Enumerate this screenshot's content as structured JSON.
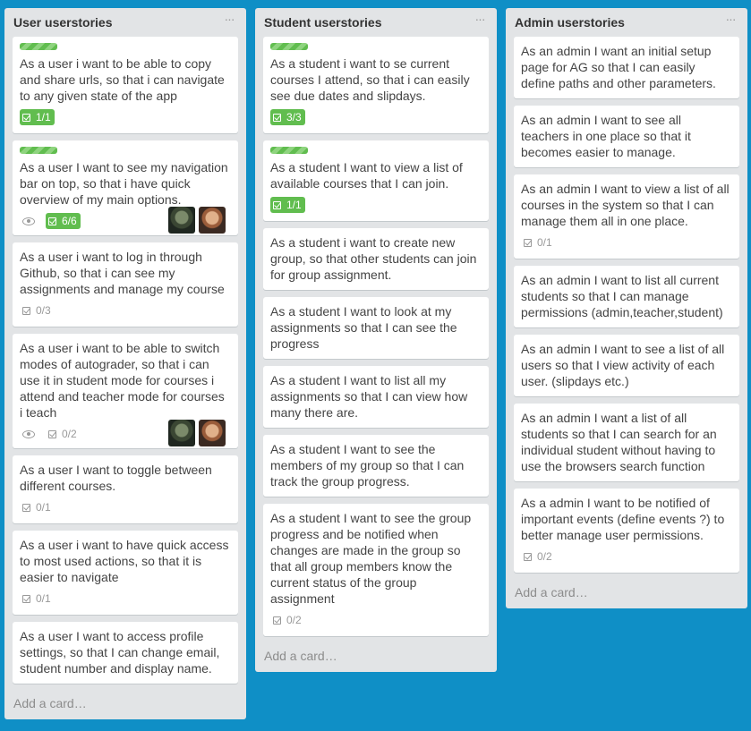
{
  "lists": [
    {
      "title": "User userstories",
      "menu": "···",
      "add_card": "Add a card…",
      "cards": [
        {
          "label": true,
          "title": "As a user i want to be able to copy and share urls, so that i can navigate to any given state of the app",
          "checklist": "1/1",
          "complete": true,
          "watch": false,
          "members": []
        },
        {
          "label": true,
          "title": "As a user I want to see my navigation bar on top, so that i have quick overview of my main options.",
          "checklist": "6/6",
          "complete": true,
          "watch": true,
          "members": [
            "a",
            "b"
          ]
        },
        {
          "label": false,
          "title": "As a user i want to log in through Github, so that i can see my assignments and manage my course",
          "checklist": "0/3",
          "complete": false,
          "watch": false,
          "members": []
        },
        {
          "label": false,
          "title": "As a user i want to be able to switch modes of autograder, so that i can use it in student mode for courses i attend and teacher mode for courses i teach",
          "checklist": "0/2",
          "complete": false,
          "watch": true,
          "members": [
            "a",
            "b"
          ]
        },
        {
          "label": false,
          "title": "As a user I want to toggle between different courses.",
          "checklist": "0/1",
          "complete": false,
          "watch": false,
          "members": []
        },
        {
          "label": false,
          "title": "As a user i want to have quick access to most used actions, so that it is easier to navigate",
          "checklist": "0/1",
          "complete": false,
          "watch": false,
          "members": []
        },
        {
          "label": false,
          "title": "As a user I want to access profile settings, so that I can change email, student number and display name.",
          "checklist": null,
          "complete": false,
          "watch": false,
          "members": []
        }
      ]
    },
    {
      "title": "Student userstories",
      "menu": "···",
      "add_card": "Add a card…",
      "cards": [
        {
          "label": true,
          "title": "As a student i want to se current courses I attend, so that i can easily see due dates and slipdays.",
          "checklist": "3/3",
          "complete": true,
          "watch": false,
          "members": []
        },
        {
          "label": true,
          "title": "As a student I want to view a list of available courses that I can join.",
          "checklist": "1/1",
          "complete": true,
          "watch": false,
          "members": []
        },
        {
          "label": false,
          "title": "As a student i want to create new group, so that other students can join for group assignment.",
          "checklist": null,
          "complete": false,
          "watch": false,
          "members": []
        },
        {
          "label": false,
          "title": "As a student I want to look at my assignments so that I can see the progress",
          "checklist": null,
          "complete": false,
          "watch": false,
          "members": []
        },
        {
          "label": false,
          "title": "As a student I want to list all my assignments so that I can view how many there are.",
          "checklist": null,
          "complete": false,
          "watch": false,
          "members": []
        },
        {
          "label": false,
          "title": "As a student I want to see the members of my group so that I can track the group progress.",
          "checklist": null,
          "complete": false,
          "watch": false,
          "members": []
        },
        {
          "label": false,
          "title": "As a student I want to see the group progress and be notified when changes are made in the group so that all group members know the current status of the group assignment",
          "checklist": "0/2",
          "complete": false,
          "watch": false,
          "members": []
        }
      ]
    },
    {
      "title": "Admin userstories",
      "menu": "···",
      "add_card": "Add a card…",
      "cards": [
        {
          "label": false,
          "title": "As an admin I want an initial setup page for AG so that I can easily define paths and other parameters.",
          "checklist": null,
          "complete": false,
          "watch": false,
          "members": []
        },
        {
          "label": false,
          "title": "As an admin I want to see all teachers in one place so that it becomes easier to manage.",
          "checklist": null,
          "complete": false,
          "watch": false,
          "members": []
        },
        {
          "label": false,
          "title": "As an admin I want to view a list of all courses in the system so that I can manage them all in one place.",
          "checklist": "0/1",
          "complete": false,
          "watch": false,
          "members": []
        },
        {
          "label": false,
          "title": "As an admin I want to list all current students so that I can manage permissions (admin,teacher,student)",
          "checklist": null,
          "complete": false,
          "watch": false,
          "members": []
        },
        {
          "label": false,
          "title": "As an admin I want to see a list of all users so that I view activity of each user. (slipdays etc.)",
          "checklist": null,
          "complete": false,
          "watch": false,
          "members": []
        },
        {
          "label": false,
          "title": "As an admin I want a list of all students so that I can search for an individual student without having to use the browsers search function",
          "checklist": null,
          "complete": false,
          "watch": false,
          "members": []
        },
        {
          "label": false,
          "title": "As a admin I want to be notified of important events (define events ?) to better manage user permissions.",
          "checklist": "0/2",
          "complete": false,
          "watch": false,
          "members": []
        }
      ]
    }
  ],
  "colors": {
    "board_background": "#0f8fc6",
    "list_background": "#e2e4e6",
    "complete_badge": "#61bd4f",
    "label_green": "#61bd4f"
  }
}
